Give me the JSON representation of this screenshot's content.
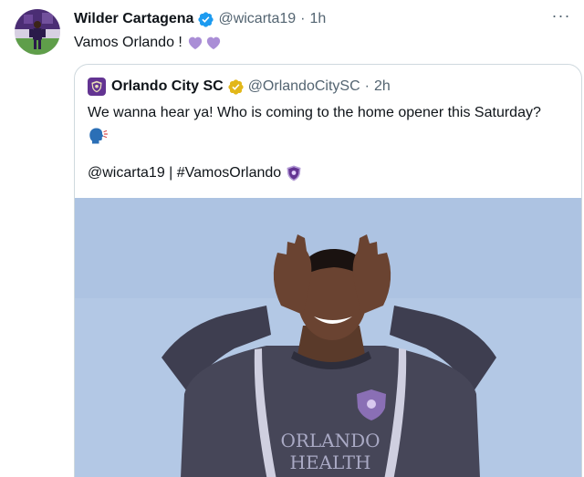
{
  "tweet": {
    "author": {
      "display_name": "Wilder Cartagena",
      "handle": "@wicarta19",
      "verified_icon": "blue-verified-badge-icon"
    },
    "separator": "·",
    "time": "1h",
    "text": "Vamos Orlando !",
    "text_emojis": [
      "purple-heart",
      "purple-heart"
    ],
    "more_icon": "more-options-icon",
    "more_label": "···"
  },
  "quote": {
    "author": {
      "display_name": "Orlando City SC",
      "handle": "@OrlandoCitySC",
      "verified_icon": "gold-verified-badge-icon"
    },
    "separator": "·",
    "time": "2h",
    "text": "We wanna hear ya! Who is coming to the home opener this Saturday?",
    "emoji": "speaking-head",
    "tags": "@wicarta19 | #VamosOrlando",
    "tag_emoji": "orlando-city-shield",
    "media": {
      "description_icon": "player-photo",
      "shirt_text_line1": "ORLANDO",
      "shirt_text_line2": "HEALTH"
    }
  },
  "colors": {
    "text": "#0f1419",
    "secondary": "#536471",
    "border": "#cfd9de",
    "verified_blue": "#1d9bf0",
    "verified_gold": "#e2b719",
    "orlando_purple": "#633492"
  }
}
